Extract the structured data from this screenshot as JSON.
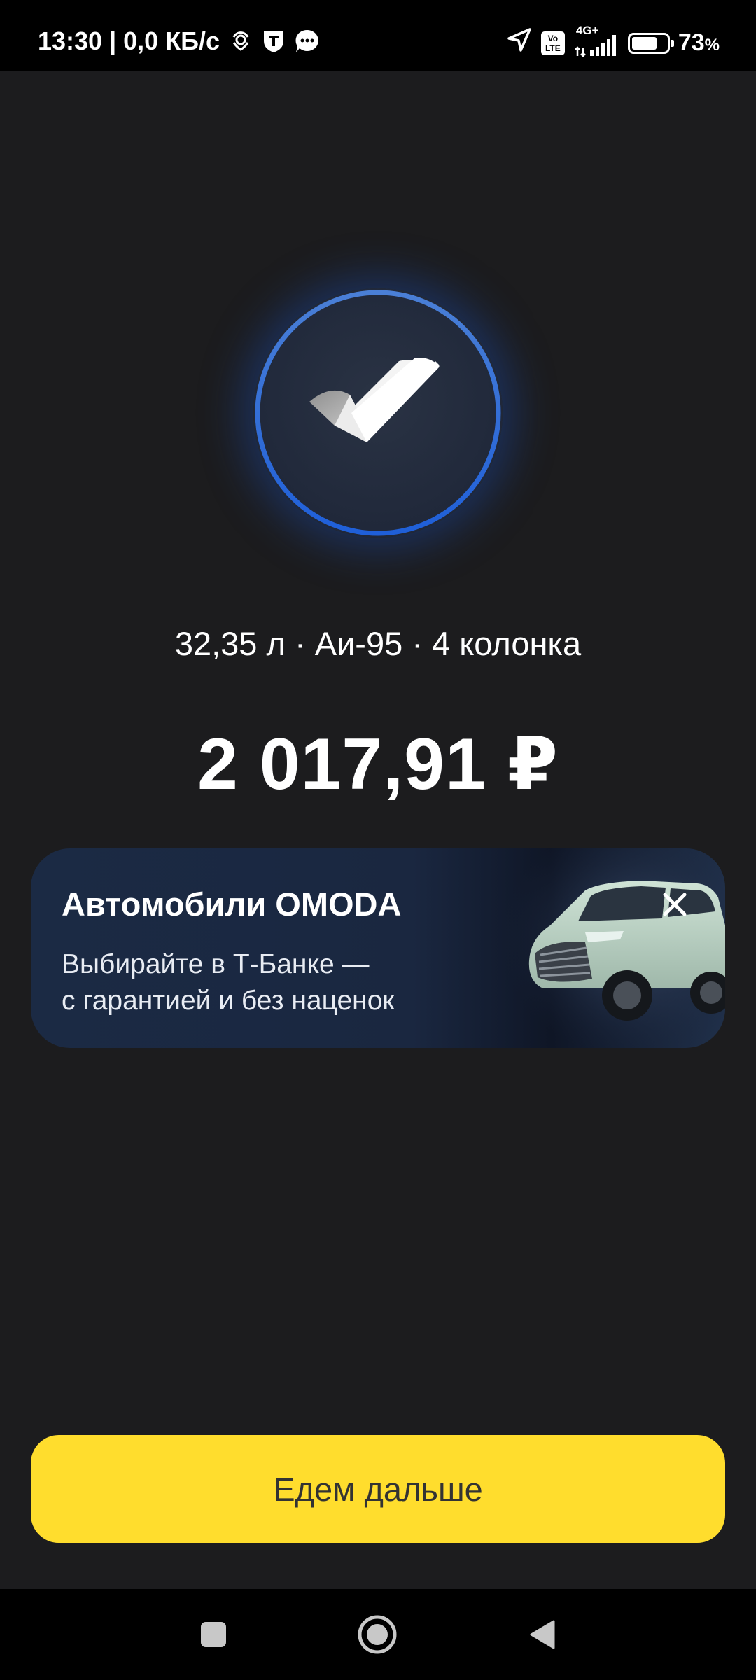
{
  "status_bar": {
    "time": "13:30",
    "separator": "|",
    "network_speed": "0,0 КБ/с",
    "volte_top": "Vo",
    "volte_bottom": "LTE",
    "network_type": "4G+",
    "battery_level": 0.73,
    "battery_percent": "73",
    "battery_percent_sign": "%",
    "icons": [
      "location-pin-icon",
      "shield-t-icon",
      "chat-bubble-icon",
      "navigation-arrow-icon",
      "volte-icon",
      "signal-icon",
      "battery-icon"
    ]
  },
  "result": {
    "icon": "check-icon",
    "summary": "32,35 л · Аи-95 · 4 колонка",
    "amount": "2 017,91 ₽"
  },
  "promo": {
    "title": "Автомобили OMODA",
    "text_line1": "Выбирайте в Т-Банке —",
    "text_line2": "с гарантией и без наценок",
    "close_icon": "close-icon",
    "image": "car-image"
  },
  "primary_button": {
    "label": "Едем дальше",
    "color": "#ffdd2d"
  },
  "nav_bar": {
    "buttons": [
      "recents-square-icon",
      "home-circle-icon",
      "back-triangle-icon"
    ]
  },
  "colors": {
    "background": "#1c1c1e",
    "accent_blue": "#2f6fe0"
  }
}
